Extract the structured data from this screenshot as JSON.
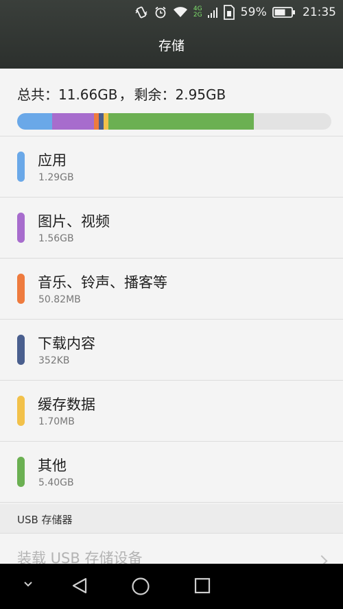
{
  "status_bar": {
    "network_top": "4G",
    "network_bottom": "2G",
    "battery_percent": "59%",
    "time": "21:35",
    "icons": [
      "vibrate-icon",
      "alarm-icon",
      "wifi-icon",
      "signal-icon",
      "sim-icon",
      "battery-icon"
    ]
  },
  "header": {
    "title": "存储"
  },
  "summary": {
    "total_label": "总共：",
    "total_value": "11.66GB",
    "separator": "，",
    "free_label": "剩余：",
    "free_value": "2.95GB"
  },
  "usage_bar": {
    "segments": [
      {
        "name": "应用",
        "fraction": 0.111,
        "color": "#6aa8e8"
      },
      {
        "name": "图片、视频",
        "fraction": 0.134,
        "color": "#a76ccd"
      },
      {
        "name": "音乐、铃声、播客等",
        "fraction": 0.015,
        "color": "#ee7b3e"
      },
      {
        "name": "下载内容",
        "fraction": 0.015,
        "color": "#4a5f8e"
      },
      {
        "name": "缓存数据",
        "fraction": 0.015,
        "color": "#f2c14a"
      },
      {
        "name": "其他",
        "fraction": 0.463,
        "color": "#6bb052"
      }
    ],
    "remaining_color": "#e3e3e3"
  },
  "items": [
    {
      "name": "应用",
      "size": "1.29GB",
      "color": "#6aa8e8"
    },
    {
      "name": "图片、视频",
      "size": "1.56GB",
      "color": "#a76ccd"
    },
    {
      "name": "音乐、铃声、播客等",
      "size": "50.82MB",
      "color": "#ee7b3e"
    },
    {
      "name": "下载内容",
      "size": "352KB",
      "color": "#4a5f8e"
    },
    {
      "name": "缓存数据",
      "size": "1.70MB",
      "color": "#f2c14a"
    },
    {
      "name": "其他",
      "size": "5.40GB",
      "color": "#6bb052"
    }
  ],
  "usb_section": {
    "header": "USB 存储器",
    "mount_label": "装载 USB 存储设备"
  },
  "nav_bar": {
    "buttons": [
      "hide-nav-chevron-icon",
      "back-icon",
      "home-icon",
      "recents-icon"
    ]
  }
}
